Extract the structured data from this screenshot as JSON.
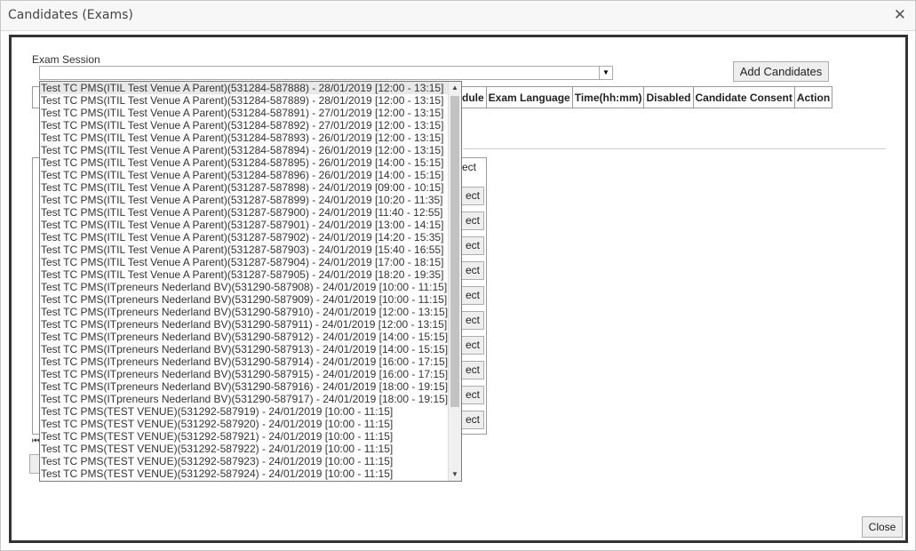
{
  "window": {
    "title": "Candidates (Exams)"
  },
  "session": {
    "label": "Exam Session",
    "value": ""
  },
  "buttons": {
    "add_candidates": "Add Candidates",
    "close": "Close"
  },
  "table_header": [
    "dule",
    "Exam Language",
    "Time(hh:mm)",
    "Disabled",
    "Candidate Consent",
    "Action"
  ],
  "partial_list": {
    "header": "ect",
    "row_button": "ect"
  },
  "dropdown_options": [
    "Test TC PMS(ITIL Test Venue A Parent)(531284-587888) - 28/01/2019 [12:00 - 13:15]",
    "Test TC PMS(ITIL Test Venue A Parent)(531284-587889) - 28/01/2019 [12:00 - 13:15]",
    "Test TC PMS(ITIL Test Venue A Parent)(531284-587891) - 27/01/2019 [12:00 - 13:15]",
    "Test TC PMS(ITIL Test Venue A Parent)(531284-587892) - 27/01/2019 [12:00 - 13:15]",
    "Test TC PMS(ITIL Test Venue A Parent)(531284-587893) - 26/01/2019 [12:00 - 13:15]",
    "Test TC PMS(ITIL Test Venue A Parent)(531284-587894) - 26/01/2019 [12:00 - 13:15]",
    "Test TC PMS(ITIL Test Venue A Parent)(531284-587895) - 26/01/2019 [14:00 - 15:15]",
    "Test TC PMS(ITIL Test Venue A Parent)(531284-587896) - 26/01/2019 [14:00 - 15:15]",
    "Test TC PMS(ITIL Test Venue A Parent)(531287-587898) - 24/01/2019 [09:00 - 10:15]",
    "Test TC PMS(ITIL Test Venue A Parent)(531287-587899) - 24/01/2019 [10:20 - 11:35]",
    "Test TC PMS(ITIL Test Venue A Parent)(531287-587900) - 24/01/2019 [11:40 - 12:55]",
    "Test TC PMS(ITIL Test Venue A Parent)(531287-587901) - 24/01/2019 [13:00 - 14:15]",
    "Test TC PMS(ITIL Test Venue A Parent)(531287-587902) - 24/01/2019 [14:20 - 15:35]",
    "Test TC PMS(ITIL Test Venue A Parent)(531287-587903) - 24/01/2019 [15:40 - 16:55]",
    "Test TC PMS(ITIL Test Venue A Parent)(531287-587904) - 24/01/2019 [17:00 - 18:15]",
    "Test TC PMS(ITIL Test Venue A Parent)(531287-587905) - 24/01/2019 [18:20 - 19:35]",
    "Test TC PMS(ITpreneurs Nederland BV)(531290-587908) - 24/01/2019 [10:00 - 11:15]",
    "Test TC PMS(ITpreneurs Nederland BV)(531290-587909) - 24/01/2019 [10:00 - 11:15]",
    "Test TC PMS(ITpreneurs Nederland BV)(531290-587910) - 24/01/2019 [12:00 - 13:15]",
    "Test TC PMS(ITpreneurs Nederland BV)(531290-587911) - 24/01/2019 [12:00 - 13:15]",
    "Test TC PMS(ITpreneurs Nederland BV)(531290-587912) - 24/01/2019 [14:00 - 15:15]",
    "Test TC PMS(ITpreneurs Nederland BV)(531290-587913) - 24/01/2019 [14:00 - 15:15]",
    "Test TC PMS(ITpreneurs Nederland BV)(531290-587914) - 24/01/2019 [16:00 - 17:15]",
    "Test TC PMS(ITpreneurs Nederland BV)(531290-587915) - 24/01/2019 [16:00 - 17:15]",
    "Test TC PMS(ITpreneurs Nederland BV)(531290-587916) - 24/01/2019 [18:00 - 19:15]",
    "Test TC PMS(ITpreneurs Nederland BV)(531290-587917) - 24/01/2019 [18:00 - 19:15]",
    "Test TC PMS(TEST VENUE)(531292-587919) - 24/01/2019 [10:00 - 11:15]",
    "Test TC PMS(TEST VENUE)(531292-587920) - 24/01/2019 [10:00 - 11:15]",
    "Test TC PMS(TEST VENUE)(531292-587921) - 24/01/2019 [10:00 - 11:15]",
    "Test TC PMS(TEST VENUE)(531292-587922) - 24/01/2019 [10:00 - 11:15]",
    "Test TC PMS(TEST VENUE)(531292-587923) - 24/01/2019 [10:00 - 11:15]",
    "Test TC PMS(TEST VENUE)(531292-587924) - 24/01/2019 [10:00 - 11:15]"
  ],
  "icons": {
    "close": "close-icon",
    "dropdown": "chevron-down-icon",
    "scroll_up": "scroll-up-icon",
    "scroll_down": "scroll-down-icon"
  }
}
